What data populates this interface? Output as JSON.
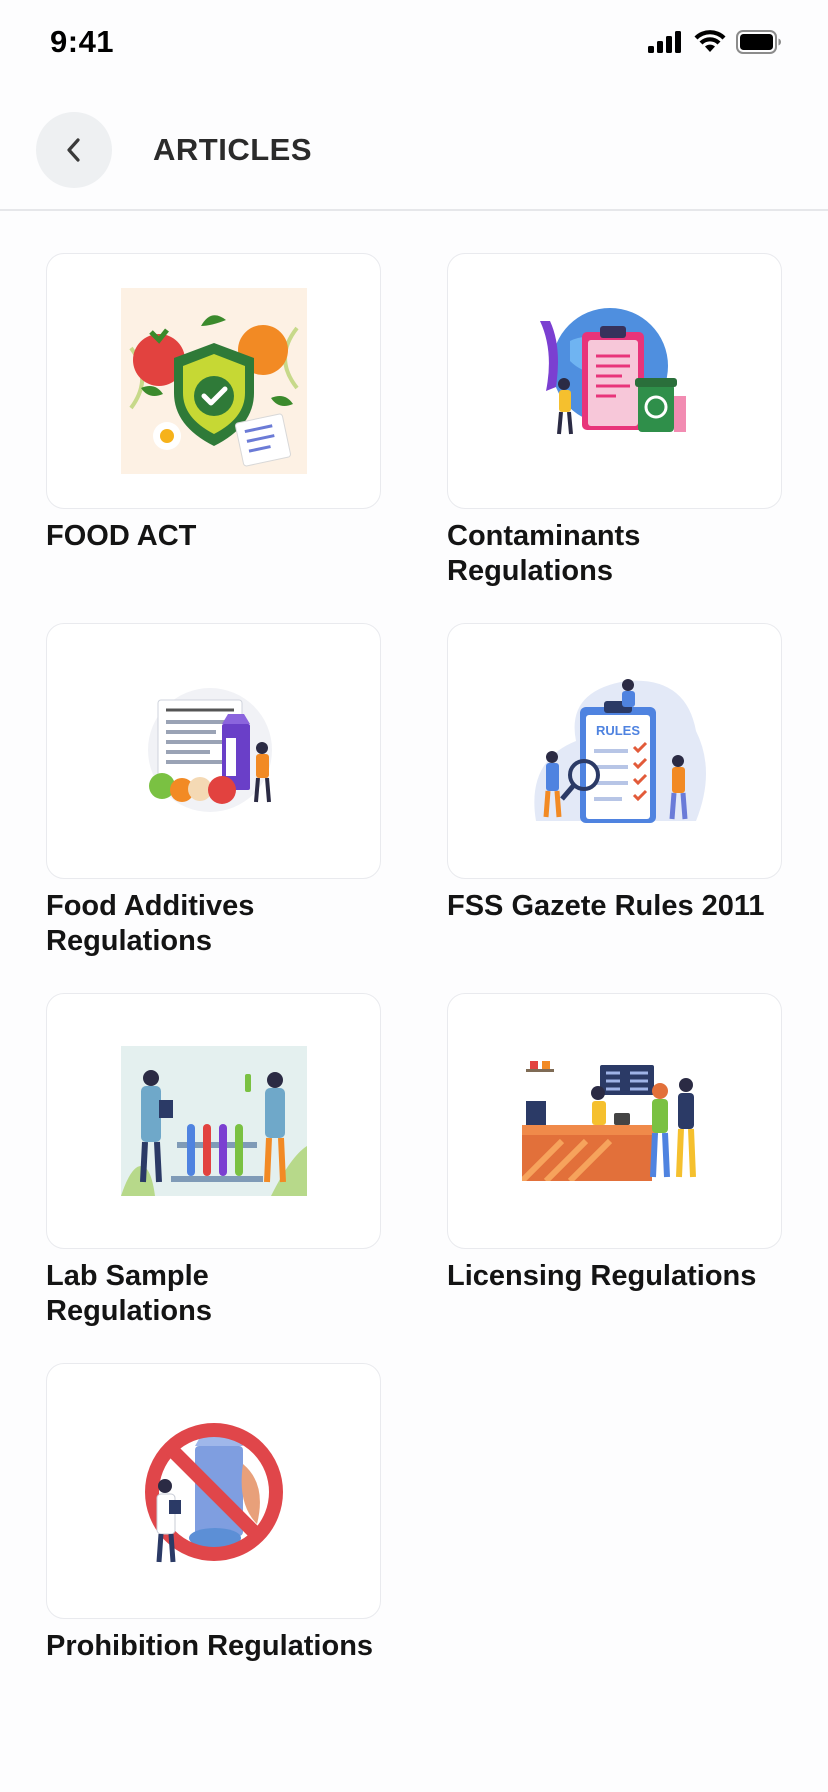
{
  "status": {
    "time": "9:41"
  },
  "header": {
    "title": "ARTICLES"
  },
  "articles": [
    {
      "label": "FOOD ACT",
      "icon": "food-safety-shield-illustration"
    },
    {
      "label": "Contaminants Regulations",
      "icon": "clipboard-globe-recycle-illustration"
    },
    {
      "label": "Food Additives Regulations",
      "icon": "nutrition-facts-milk-illustration"
    },
    {
      "label": "FSS Gazete Rules 2011",
      "icon": "rules-checklist-illustration",
      "illustration_text": "RULES"
    },
    {
      "label": "Lab Sample Regulations",
      "icon": "lab-test-tubes-illustration"
    },
    {
      "label": "Licensing Regulations",
      "icon": "shop-counter-illustration"
    },
    {
      "label": "Prohibition Regulations",
      "icon": "prohibited-food-illustration"
    }
  ],
  "colors": {
    "accent_green": "#2e8b3e",
    "prohibit_red": "#e0464a",
    "tile_border": "#e9eaee"
  }
}
